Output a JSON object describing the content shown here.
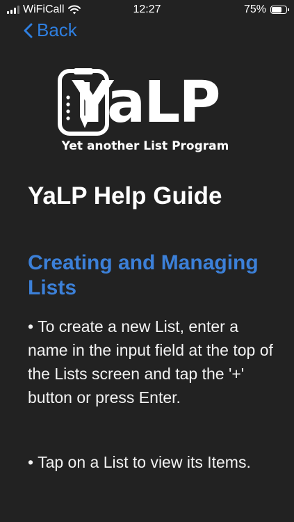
{
  "status_bar": {
    "carrier": "WiFiCall",
    "time": "12:27",
    "battery_percent": "75%",
    "battery_level": 0.75,
    "signal_bars_active": 3
  },
  "nav": {
    "back_label": "Back"
  },
  "logo": {
    "name": "YaLP",
    "tagline": "Yet another List Program"
  },
  "page": {
    "title": "YaLP Help Guide"
  },
  "section": {
    "heading": "Creating and Managing Lists",
    "bullets": [
      "To create a new List, enter a name in the input field at the top of the Lists screen and tap the '+' button or press Enter.",
      "Tap on a List to view its Items."
    ]
  },
  "colors": {
    "background": "#222222",
    "accent": "#2f7fe0",
    "heading": "#3c80d8"
  }
}
